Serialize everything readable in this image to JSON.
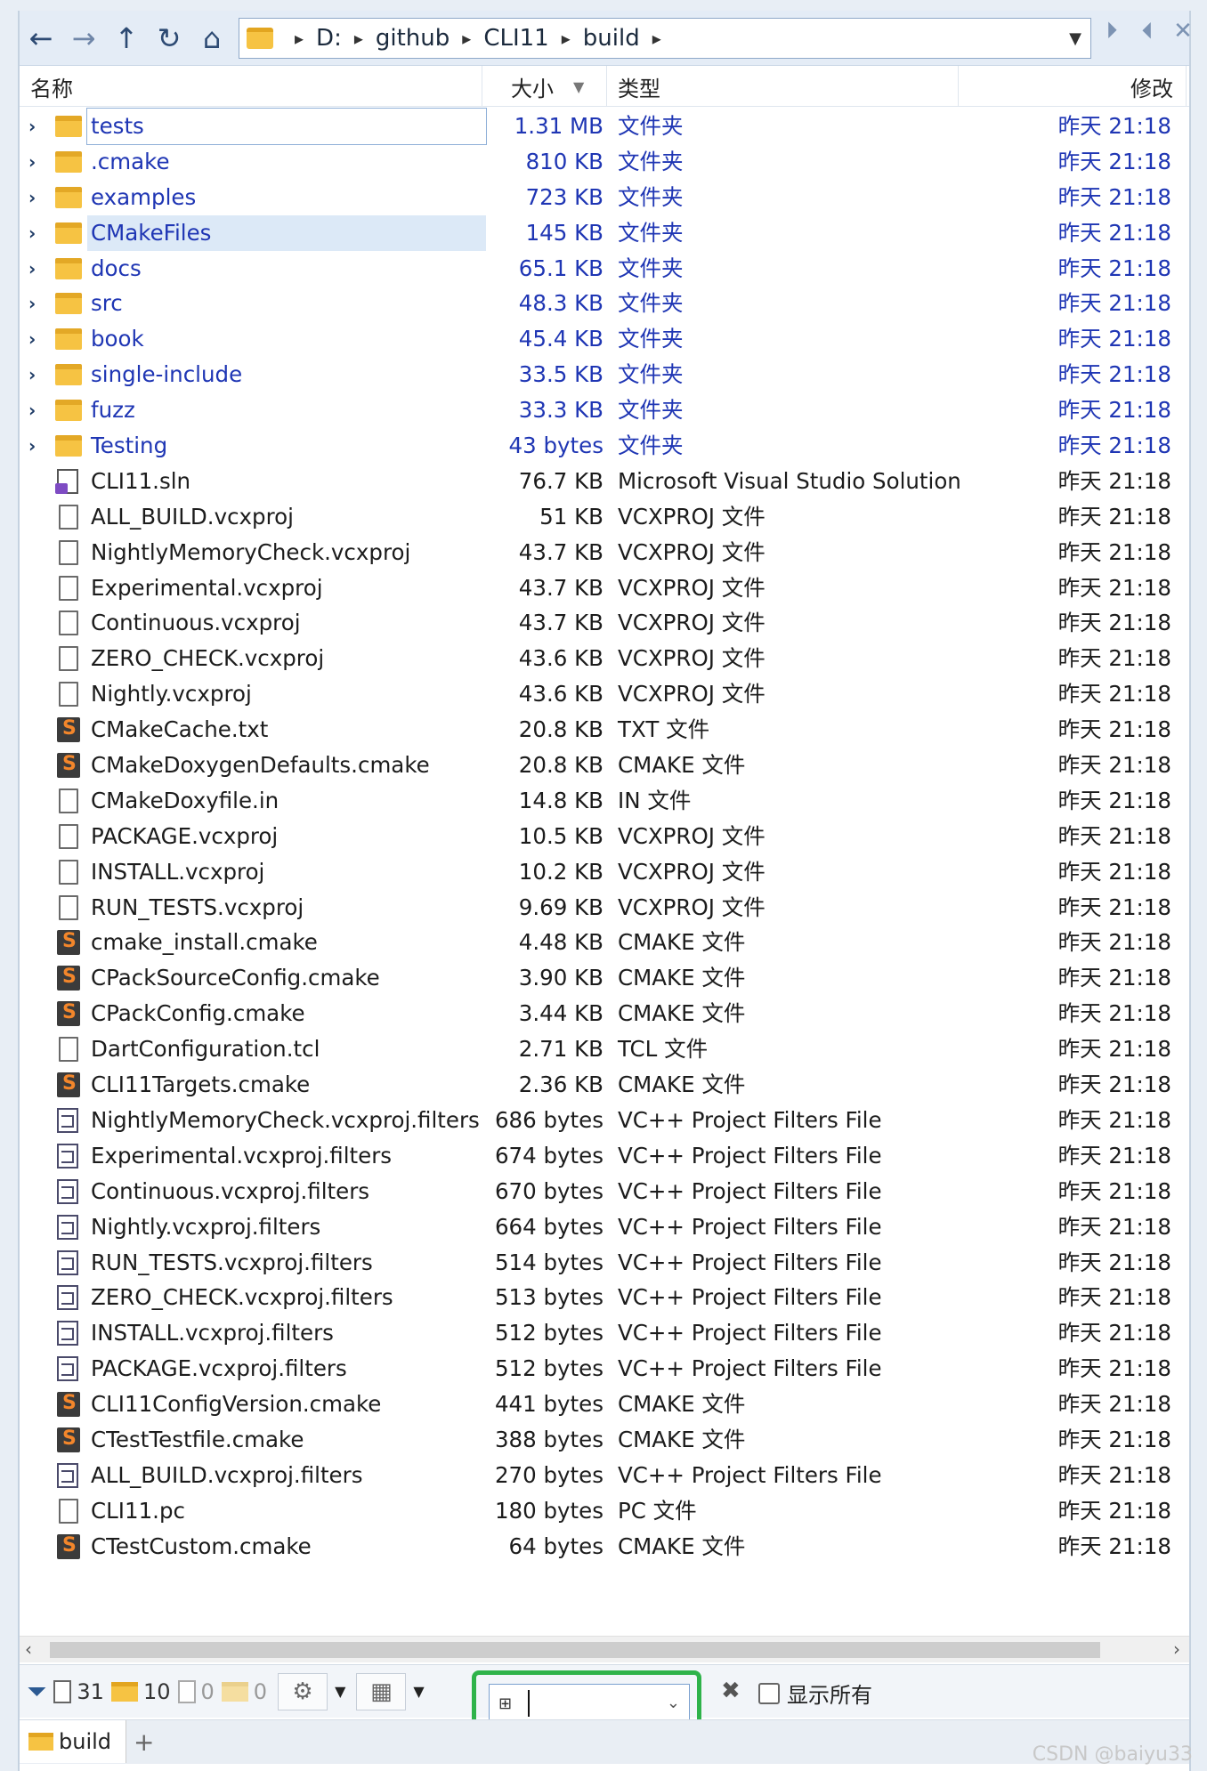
{
  "nav": {
    "back": "←",
    "forward": "→",
    "up": "↑",
    "refresh": "↻",
    "home": "⌂"
  },
  "path": [
    "D:",
    "github",
    "CLI11",
    "build"
  ],
  "window_buttons": [
    "⏵",
    "⏴",
    "✕"
  ],
  "columns": {
    "name": "名称",
    "size": "大小",
    "type": "类型",
    "date": "修改"
  },
  "rows": [
    {
      "name": "tests",
      "size": "1.31 MB",
      "type": "文件夹",
      "date": "昨天  21:18",
      "kind": "folder",
      "state": "focused"
    },
    {
      "name": ".cmake",
      "size": "810 KB",
      "type": "文件夹",
      "date": "昨天  21:18",
      "kind": "folder"
    },
    {
      "name": "examples",
      "size": "723 KB",
      "type": "文件夹",
      "date": "昨天  21:18",
      "kind": "folder"
    },
    {
      "name": "CMakeFiles",
      "size": "145 KB",
      "type": "文件夹",
      "date": "昨天  21:18",
      "kind": "folder",
      "state": "selected"
    },
    {
      "name": "docs",
      "size": "65.1 KB",
      "type": "文件夹",
      "date": "昨天  21:18",
      "kind": "folder"
    },
    {
      "name": "src",
      "size": "48.3 KB",
      "type": "文件夹",
      "date": "昨天  21:18",
      "kind": "folder"
    },
    {
      "name": "book",
      "size": "45.4 KB",
      "type": "文件夹",
      "date": "昨天  21:18",
      "kind": "folder"
    },
    {
      "name": "single-include",
      "size": "33.5 KB",
      "type": "文件夹",
      "date": "昨天  21:18",
      "kind": "folder"
    },
    {
      "name": "fuzz",
      "size": "33.3 KB",
      "type": "文件夹",
      "date": "昨天  21:18",
      "kind": "folder"
    },
    {
      "name": "Testing",
      "size": "43 bytes",
      "type": "文件夹",
      "date": "昨天  21:18",
      "kind": "folder"
    },
    {
      "name": "CLI11.sln",
      "size": "76.7 KB",
      "type": "Microsoft Visual Studio Solution",
      "date": "昨天  21:18",
      "kind": "sln"
    },
    {
      "name": "ALL_BUILD.vcxproj",
      "size": "51 KB",
      "type": "VCXPROJ 文件",
      "date": "昨天  21:18",
      "kind": "file"
    },
    {
      "name": "NightlyMemoryCheck.vcxproj",
      "size": "43.7 KB",
      "type": "VCXPROJ 文件",
      "date": "昨天  21:18",
      "kind": "file"
    },
    {
      "name": "Experimental.vcxproj",
      "size": "43.7 KB",
      "type": "VCXPROJ 文件",
      "date": "昨天  21:18",
      "kind": "file"
    },
    {
      "name": "Continuous.vcxproj",
      "size": "43.7 KB",
      "type": "VCXPROJ 文件",
      "date": "昨天  21:18",
      "kind": "file"
    },
    {
      "name": "ZERO_CHECK.vcxproj",
      "size": "43.6 KB",
      "type": "VCXPROJ 文件",
      "date": "昨天  21:18",
      "kind": "file"
    },
    {
      "name": "Nightly.vcxproj",
      "size": "43.6 KB",
      "type": "VCXPROJ 文件",
      "date": "昨天  21:18",
      "kind": "file"
    },
    {
      "name": "CMakeCache.txt",
      "size": "20.8 KB",
      "type": "TXT 文件",
      "date": "昨天  21:18",
      "kind": "cmake"
    },
    {
      "name": "CMakeDoxygenDefaults.cmake",
      "size": "20.8 KB",
      "type": "CMAKE 文件",
      "date": "昨天  21:18",
      "kind": "cmake"
    },
    {
      "name": "CMakeDoxyfile.in",
      "size": "14.8 KB",
      "type": "IN 文件",
      "date": "昨天  21:18",
      "kind": "file"
    },
    {
      "name": "PACKAGE.vcxproj",
      "size": "10.5 KB",
      "type": "VCXPROJ 文件",
      "date": "昨天  21:18",
      "kind": "file"
    },
    {
      "name": "INSTALL.vcxproj",
      "size": "10.2 KB",
      "type": "VCXPROJ 文件",
      "date": "昨天  21:18",
      "kind": "file"
    },
    {
      "name": "RUN_TESTS.vcxproj",
      "size": "9.69 KB",
      "type": "VCXPROJ 文件",
      "date": "昨天  21:18",
      "kind": "file"
    },
    {
      "name": "cmake_install.cmake",
      "size": "4.48 KB",
      "type": "CMAKE 文件",
      "date": "昨天  21:18",
      "kind": "cmake"
    },
    {
      "name": "CPackSourceConfig.cmake",
      "size": "3.90 KB",
      "type": "CMAKE 文件",
      "date": "昨天  21:18",
      "kind": "cmake"
    },
    {
      "name": "CPackConfig.cmake",
      "size": "3.44 KB",
      "type": "CMAKE 文件",
      "date": "昨天  21:18",
      "kind": "cmake"
    },
    {
      "name": "DartConfiguration.tcl",
      "size": "2.71 KB",
      "type": "TCL 文件",
      "date": "昨天  21:18",
      "kind": "file"
    },
    {
      "name": "CLI11Targets.cmake",
      "size": "2.36 KB",
      "type": "CMAKE 文件",
      "date": "昨天  21:18",
      "kind": "cmake"
    },
    {
      "name": "NightlyMemoryCheck.vcxproj.filters",
      "size": "686 bytes",
      "type": "VC++ Project Filters File",
      "date": "昨天  21:18",
      "kind": "filter"
    },
    {
      "name": "Experimental.vcxproj.filters",
      "size": "674 bytes",
      "type": "VC++ Project Filters File",
      "date": "昨天  21:18",
      "kind": "filter"
    },
    {
      "name": "Continuous.vcxproj.filters",
      "size": "670 bytes",
      "type": "VC++ Project Filters File",
      "date": "昨天  21:18",
      "kind": "filter"
    },
    {
      "name": "Nightly.vcxproj.filters",
      "size": "664 bytes",
      "type": "VC++ Project Filters File",
      "date": "昨天  21:18",
      "kind": "filter"
    },
    {
      "name": "RUN_TESTS.vcxproj.filters",
      "size": "514 bytes",
      "type": "VC++ Project Filters File",
      "date": "昨天  21:18",
      "kind": "filter"
    },
    {
      "name": "ZERO_CHECK.vcxproj.filters",
      "size": "513 bytes",
      "type": "VC++ Project Filters File",
      "date": "昨天  21:18",
      "kind": "filter"
    },
    {
      "name": "INSTALL.vcxproj.filters",
      "size": "512 bytes",
      "type": "VC++ Project Filters File",
      "date": "昨天  21:18",
      "kind": "filter"
    },
    {
      "name": "PACKAGE.vcxproj.filters",
      "size": "512 bytes",
      "type": "VC++ Project Filters File",
      "date": "昨天  21:18",
      "kind": "filter"
    },
    {
      "name": "CLI11ConfigVersion.cmake",
      "size": "441 bytes",
      "type": "CMAKE 文件",
      "date": "昨天  21:18",
      "kind": "cmake"
    },
    {
      "name": "CTestTestfile.cmake",
      "size": "388 bytes",
      "type": "CMAKE 文件",
      "date": "昨天  21:18",
      "kind": "cmake"
    },
    {
      "name": "ALL_BUILD.vcxproj.filters",
      "size": "270 bytes",
      "type": "VC++ Project Filters File",
      "date": "昨天  21:18",
      "kind": "filter"
    },
    {
      "name": "CLI11.pc",
      "size": "180 bytes",
      "type": "PC 文件",
      "date": "昨天  21:18",
      "kind": "file"
    },
    {
      "name": "CTestCustom.cmake",
      "size": "64 bytes",
      "type": "CMAKE 文件",
      "date": "昨天  21:18",
      "kind": "cmake"
    }
  ],
  "toolbar": {
    "file_count": "31",
    "folder_count": "10",
    "hidden_file_count": "0",
    "hidden_folder_count": "0",
    "search_value": "",
    "clear": "✖",
    "show_all_label": "显示所有"
  },
  "tabs": [
    {
      "label": "build"
    }
  ],
  "tab_add": "+",
  "watermark": "CSDN @baiyu33",
  "colors": {
    "accent": "#1f36b4",
    "highlight": "#2fb34a",
    "folder": "#f6c343"
  }
}
